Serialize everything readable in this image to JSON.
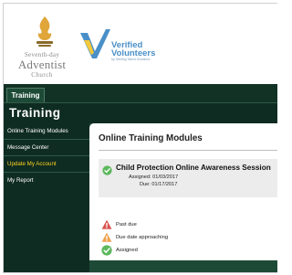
{
  "logos": {
    "sda": {
      "line1": "Seventh-day",
      "line2": "Adventist",
      "line3": "Church"
    },
    "vv": {
      "line1": "Verified",
      "line2": "Volunteers",
      "tagline": "by Sterling Talent Solutions"
    }
  },
  "tabs": [
    {
      "label": "Training"
    }
  ],
  "page_title": "Training",
  "sidebar": {
    "items": [
      {
        "label": "Online Training Modules",
        "active": false
      },
      {
        "label": "Message Center",
        "active": false
      },
      {
        "label": "Update My Account",
        "active": true
      },
      {
        "label": "My Report",
        "active": false
      }
    ]
  },
  "main": {
    "section_title": "Online Training Modules",
    "session": {
      "title": "Child Protection Online Awareness Session",
      "assigned": "Assigned: 01/03/2017",
      "due": "Due: 01/17/2017",
      "status_icon": "check-circle-icon"
    },
    "legend": [
      {
        "label": "Past due",
        "icon": "warning-red-icon"
      },
      {
        "label": "Due date approaching",
        "icon": "warning-orange-icon"
      },
      {
        "label": "Assigned",
        "icon": "check-circle-icon"
      }
    ]
  },
  "colors": {
    "nav_bg": "#0f2c22",
    "panel_bg": "#1d4a36",
    "active_nav": "#ffd21f",
    "assigned_green": "#5cb85c",
    "past_due_red": "#d9534f",
    "approaching_orange": "#f0a04b",
    "brand_blue": "#4a90c8"
  }
}
